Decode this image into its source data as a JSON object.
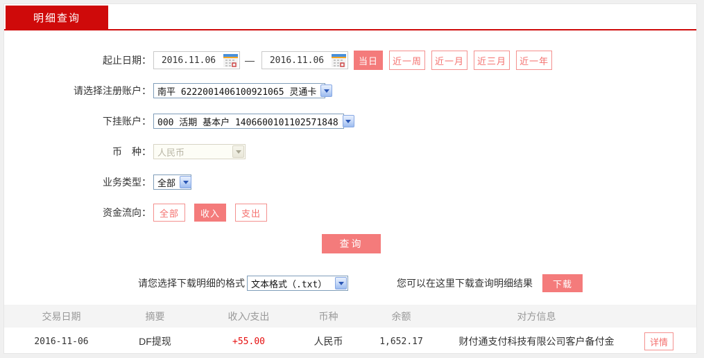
{
  "tab": {
    "label": "明细查询"
  },
  "form": {
    "date_row": {
      "label": "起止日期：",
      "start_date": "2016.11.06",
      "end_date": "2016.11.06",
      "separator": "—",
      "quick_buttons": [
        {
          "label": "当日",
          "active": true
        },
        {
          "label": "近一周",
          "active": false
        },
        {
          "label": "近一月",
          "active": false
        },
        {
          "label": "近三月",
          "active": false
        },
        {
          "label": "近一年",
          "active": false
        }
      ]
    },
    "register_account": {
      "label": "请选择注册账户：",
      "value": "南平 6222001406100921065 灵通卡"
    },
    "linked_account": {
      "label": "下挂账户：",
      "value": "000 活期 基本户 1406600101102571848"
    },
    "currency": {
      "label": "币　种：",
      "value": "人民币",
      "disabled": true
    },
    "business_type": {
      "label": "业务类型：",
      "value": "全部"
    },
    "fund_direction": {
      "label": "资金流向：",
      "options": [
        {
          "label": "全部",
          "active": false
        },
        {
          "label": "收入",
          "active": true
        },
        {
          "label": "支出",
          "active": false
        }
      ]
    },
    "query_button": "查询"
  },
  "download": {
    "format_label": "请您选择下载明细的格式",
    "format_value": "文本格式（.txt）",
    "hint": "您可以在这里下载查询明细结果",
    "button": "下载"
  },
  "table": {
    "headers": [
      "交易日期",
      "摘要",
      "收入/支出",
      "币种",
      "余额",
      "对方信息"
    ],
    "rows": [
      {
        "date": "2016-11-06",
        "summary": "DF提现",
        "amount": "+55.00",
        "currency": "人民币",
        "balance": "1,652.17",
        "counterparty": "财付通支付科技有限公司客户备付金",
        "detail_button": "详情"
      }
    ]
  },
  "colors": {
    "brand_red": "#cf0a0a",
    "accent_pink": "#f47b7b",
    "amount_red": "#e50e0e",
    "header_gray": "#999999"
  }
}
